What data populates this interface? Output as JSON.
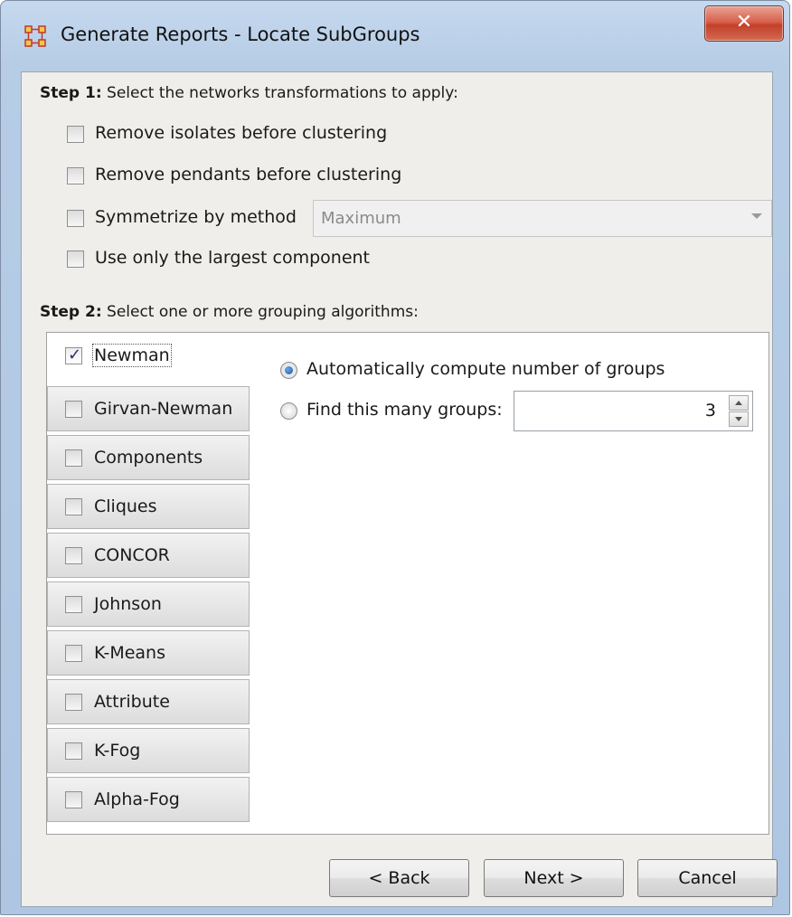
{
  "window": {
    "title": "Generate Reports - Locate SubGroups",
    "close_glyph": "✕",
    "icon": "network-icon"
  },
  "step1": {
    "heading_bold": "Step 1:",
    "heading_text": " Select the networks transformations to apply:",
    "options": [
      {
        "label": "Remove isolates before clustering",
        "checked": false
      },
      {
        "label": "Remove pendants before clustering",
        "checked": false
      },
      {
        "label": "Symmetrize by method",
        "checked": false
      },
      {
        "label": "Use only the largest component",
        "checked": false
      }
    ],
    "symmetrize_method": {
      "value": "Maximum",
      "enabled": false
    }
  },
  "step2": {
    "heading_bold": "Step 2:",
    "heading_text": " Select one or more grouping algorithms:",
    "algorithms": [
      {
        "label": "Newman",
        "checked": true,
        "active": true
      },
      {
        "label": "Girvan-Newman",
        "checked": false
      },
      {
        "label": "Components",
        "checked": false
      },
      {
        "label": "Cliques",
        "checked": false
      },
      {
        "label": "CONCOR",
        "checked": false
      },
      {
        "label": "Johnson",
        "checked": false
      },
      {
        "label": "K-Means",
        "checked": false
      },
      {
        "label": "Attribute",
        "checked": false
      },
      {
        "label": "K-Fog",
        "checked": false
      },
      {
        "label": "Alpha-Fog",
        "checked": false
      }
    ],
    "newman_panel": {
      "auto_label": "Automatically compute number of groups",
      "find_label": "Find this many groups:",
      "selected": "auto",
      "group_count": "3"
    }
  },
  "buttons": {
    "back": "< Back",
    "next": "Next >",
    "cancel": "Cancel"
  },
  "check_glyph": "✓"
}
